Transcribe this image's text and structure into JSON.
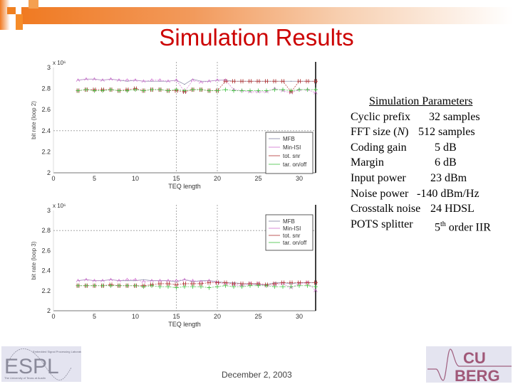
{
  "slide": {
    "title": "Simulation Results",
    "date": "December 2, 2003",
    "accent_color": "#f07a22",
    "title_color": "#cc0000"
  },
  "parameters": {
    "heading": "Simulation Parameters",
    "rows": [
      {
        "label": "Cyclic prefix",
        "value": "32 samples"
      },
      {
        "label": "FFT size (N)",
        "value": "512 samples"
      },
      {
        "label": "Coding gain",
        "value": "5 dB"
      },
      {
        "label": "Margin",
        "value": "6 dB"
      },
      {
        "label": "Input power",
        "value": "23 dBm"
      },
      {
        "label": "Noise power",
        "value": "-140 dBm/Hz"
      },
      {
        "label": "Crosstalk noise",
        "value": "24 HDSL"
      },
      {
        "label": "POTS splitter",
        "value": "5th order IIR"
      }
    ]
  },
  "logos": {
    "left": {
      "text": "ESPL",
      "top_caption": "Embedded Signal Processing Laboratory",
      "bottom_caption": "The University of Texas at Austin"
    },
    "right": {
      "line1": "CU",
      "line2": "BERG"
    }
  },
  "chart_data": [
    {
      "type": "line",
      "title": "",
      "xlabel": "TEQ length",
      "ylabel": "bit rate (loop 2)",
      "y_multiplier": "x 10^6",
      "xlim": [
        0,
        32
      ],
      "ylim": [
        2,
        3
      ],
      "xticks": [
        "0",
        "5",
        "10",
        "15",
        "20",
        "25",
        "30"
      ],
      "yticks": [
        "2",
        "2.2",
        "2.4",
        "2.6",
        "2.8",
        "3"
      ],
      "grid_marks": {
        "vertical_at_x": [
          15,
          20
        ],
        "horizontal_at_y": [
          2.4
        ]
      },
      "legend": {
        "position": "bottom-right",
        "entries": [
          "MFB",
          "Min-ISI",
          "tot. snr",
          "tar. on/off"
        ]
      },
      "x": [
        3,
        4,
        5,
        6,
        7,
        8,
        9,
        10,
        11,
        12,
        13,
        14,
        15,
        16,
        17,
        18,
        19,
        20,
        21,
        22,
        23,
        24,
        25,
        26,
        27,
        28,
        29,
        30,
        31,
        32
      ],
      "series": [
        {
          "name": "MFB",
          "color": "#8080a0",
          "values": [
            2.88,
            2.89,
            2.89,
            2.88,
            2.89,
            2.88,
            2.87,
            2.88,
            2.87,
            2.87,
            2.87,
            2.87,
            2.88,
            2.84,
            2.89,
            2.87,
            2.87,
            2.88,
            2.88,
            2.87,
            2.87,
            2.87,
            2.87,
            2.87,
            2.87,
            2.87,
            2.87,
            2.87,
            2.87,
            2.87
          ]
        },
        {
          "name": "Min-ISI",
          "color": "#d070d0",
          "values": [
            2.88,
            2.89,
            2.89,
            2.88,
            2.89,
            2.88,
            2.88,
            2.88,
            2.87,
            2.88,
            2.88,
            2.87,
            2.88,
            2.77,
            2.88,
            2.86,
            2.87,
            2.88,
            2.88,
            2.79,
            2.78,
            2.77,
            2.77,
            2.77,
            2.8,
            2.78,
            2.76,
            2.79,
            2.79,
            2.76
          ]
        },
        {
          "name": "tot. snr",
          "color": "#b03030",
          "values": [
            2.78,
            2.79,
            2.79,
            2.79,
            2.79,
            2.78,
            2.79,
            2.8,
            2.78,
            2.79,
            2.79,
            2.78,
            2.78,
            2.77,
            2.79,
            2.79,
            2.78,
            2.78,
            2.87,
            2.87,
            2.87,
            2.87,
            2.87,
            2.87,
            2.87,
            2.87,
            2.77,
            2.87,
            2.87,
            2.87
          ]
        },
        {
          "name": "tar. on/off",
          "color": "#40c040",
          "values": [
            2.78,
            2.79,
            2.78,
            2.78,
            2.79,
            2.78,
            2.78,
            2.79,
            2.78,
            2.79,
            2.79,
            2.78,
            2.79,
            2.78,
            2.79,
            2.79,
            2.78,
            2.78,
            2.79,
            2.78,
            2.78,
            2.78,
            2.78,
            2.78,
            2.79,
            2.79,
            2.78,
            2.79,
            2.79,
            2.79
          ]
        }
      ]
    },
    {
      "type": "line",
      "title": "",
      "xlabel": "TEQ length",
      "ylabel": "bit rate (loop 3)",
      "y_multiplier": "x 10^6",
      "xlim": [
        0,
        32
      ],
      "ylim": [
        2,
        3
      ],
      "xticks": [
        "0",
        "5",
        "10",
        "15",
        "20",
        "25",
        "30"
      ],
      "yticks": [
        "2",
        "2.2",
        "2.4",
        "2.6",
        "2.8",
        "3"
      ],
      "grid_marks": {
        "vertical_at_x": [
          15,
          20
        ],
        "horizontal_at_y": [
          2.8
        ]
      },
      "legend": {
        "position": "top-right",
        "entries": [
          "MFB",
          "Min-ISI",
          "tot. snr",
          "tar. on/off"
        ]
      },
      "x": [
        3,
        4,
        5,
        6,
        7,
        8,
        9,
        10,
        11,
        12,
        13,
        14,
        15,
        16,
        17,
        18,
        19,
        20,
        21,
        22,
        23,
        24,
        25,
        26,
        27,
        28,
        29,
        30,
        31,
        32
      ],
      "series": [
        {
          "name": "MFB",
          "color": "#8080a0",
          "values": [
            2.3,
            2.31,
            2.3,
            2.3,
            2.31,
            2.3,
            2.3,
            2.3,
            2.31,
            2.3,
            2.3,
            2.3,
            2.29,
            2.31,
            2.29,
            2.3,
            2.3,
            2.29,
            2.28,
            2.28,
            2.27,
            2.27,
            2.26,
            2.26,
            2.28,
            2.28,
            2.27,
            2.28,
            2.28,
            2.28
          ]
        },
        {
          "name": "Min-ISI",
          "color": "#d070d0",
          "values": [
            2.3,
            2.31,
            2.3,
            2.3,
            2.31,
            2.3,
            2.31,
            2.31,
            2.29,
            2.3,
            2.3,
            2.3,
            2.3,
            2.31,
            2.3,
            2.29,
            2.3,
            2.28,
            2.27,
            2.26,
            2.25,
            2.27,
            2.27,
            2.25,
            2.26,
            2.27,
            2.23,
            2.27,
            2.28,
            2.2
          ]
        },
        {
          "name": "tot. snr",
          "color": "#b03030",
          "values": [
            2.25,
            2.25,
            2.25,
            2.25,
            2.26,
            2.25,
            2.25,
            2.25,
            2.25,
            2.26,
            2.27,
            2.27,
            2.26,
            2.27,
            2.27,
            2.27,
            2.28,
            2.28,
            2.28,
            2.27,
            2.27,
            2.27,
            2.27,
            2.26,
            2.27,
            2.28,
            2.28,
            2.28,
            2.28,
            2.28
          ]
        },
        {
          "name": "tar. on/off",
          "color": "#40c040",
          "values": [
            2.25,
            2.25,
            2.25,
            2.25,
            2.25,
            2.25,
            2.25,
            2.25,
            2.24,
            2.25,
            2.24,
            2.24,
            2.23,
            2.24,
            2.24,
            2.24,
            2.23,
            2.24,
            2.25,
            2.24,
            2.24,
            2.25,
            2.25,
            2.25,
            2.24,
            2.24,
            2.24,
            2.25,
            2.25,
            2.24
          ]
        }
      ]
    }
  ]
}
